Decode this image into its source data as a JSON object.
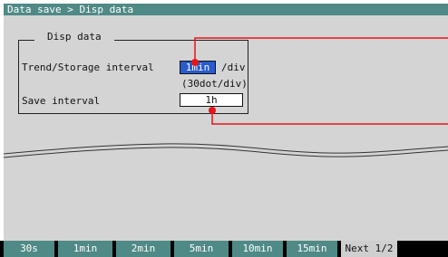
{
  "header": {
    "breadcrumb": "Data save > Disp data"
  },
  "group": {
    "title": "Disp data",
    "trend_label": "Trend/Storage interval",
    "trend_value": "1min",
    "trend_unit": "/div",
    "trend_note": "(30dot/div)",
    "save_label": "Save interval",
    "save_value": "1h"
  },
  "softkeys": [
    {
      "label": "30s"
    },
    {
      "label": "1min"
    },
    {
      "label": "2min"
    },
    {
      "label": "5min"
    },
    {
      "label": "10min"
    },
    {
      "label": "15min"
    },
    {
      "label": "Next 1/2"
    }
  ],
  "colors": {
    "title_bar": "#4f8a86",
    "selection": "#2a5bcc",
    "callout": "#e8141a",
    "panel": "#d4d4d4"
  }
}
